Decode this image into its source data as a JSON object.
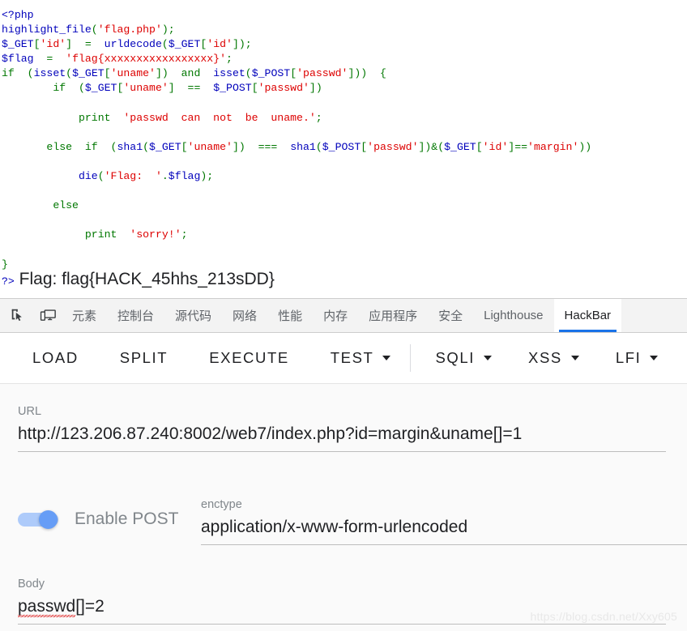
{
  "php_output": {
    "code_lines": [
      [
        {
          "t": "<?php",
          "c": "def"
        }
      ],
      [
        {
          "t": "highlight_file",
          "c": "def"
        },
        {
          "t": "(",
          "c": "kw"
        },
        {
          "t": "'flag.php'",
          "c": "str"
        },
        {
          "t": ")",
          "c": "kw"
        },
        {
          "t": ";",
          "c": "kw"
        }
      ],
      [
        {
          "t": "$_GET",
          "c": "var"
        },
        {
          "t": "[",
          "c": "kw"
        },
        {
          "t": "'id'",
          "c": "str"
        },
        {
          "t": "]",
          "c": "kw"
        },
        {
          "t": "  =  ",
          "c": "kw"
        },
        {
          "t": "urldecode",
          "c": "def"
        },
        {
          "t": "(",
          "c": "kw"
        },
        {
          "t": "$_GET",
          "c": "var"
        },
        {
          "t": "[",
          "c": "kw"
        },
        {
          "t": "'id'",
          "c": "str"
        },
        {
          "t": "]",
          "c": "kw"
        },
        {
          "t": ");",
          "c": "kw"
        }
      ],
      [
        {
          "t": "$flag",
          "c": "var"
        },
        {
          "t": "  =  ",
          "c": "kw"
        },
        {
          "t": "'flag{xxxxxxxxxxxxxxxxx}'",
          "c": "str"
        },
        {
          "t": ";",
          "c": "kw"
        }
      ],
      [
        {
          "t": "if",
          "c": "kw"
        },
        {
          "t": "  (",
          "c": "kw"
        },
        {
          "t": "isset",
          "c": "def"
        },
        {
          "t": "(",
          "c": "kw"
        },
        {
          "t": "$_GET",
          "c": "var"
        },
        {
          "t": "[",
          "c": "kw"
        },
        {
          "t": "'uname'",
          "c": "str"
        },
        {
          "t": "])",
          "c": "kw"
        },
        {
          "t": "  and  ",
          "c": "kw"
        },
        {
          "t": "isset",
          "c": "def"
        },
        {
          "t": "(",
          "c": "kw"
        },
        {
          "t": "$_POST",
          "c": "var"
        },
        {
          "t": "[",
          "c": "kw"
        },
        {
          "t": "'passwd'",
          "c": "str"
        },
        {
          "t": "]))",
          "c": "kw"
        },
        {
          "t": "  {",
          "c": "kw"
        }
      ],
      [
        {
          "t": "        ",
          "c": "kw"
        },
        {
          "t": "if",
          "c": "kw"
        },
        {
          "t": "  (",
          "c": "kw"
        },
        {
          "t": "$_GET",
          "c": "var"
        },
        {
          "t": "[",
          "c": "kw"
        },
        {
          "t": "'uname'",
          "c": "str"
        },
        {
          "t": "]",
          "c": "kw"
        },
        {
          "t": "  ==  ",
          "c": "kw"
        },
        {
          "t": "$_POST",
          "c": "var"
        },
        {
          "t": "[",
          "c": "kw"
        },
        {
          "t": "'passwd'",
          "c": "str"
        },
        {
          "t": "])",
          "c": "kw"
        }
      ],
      [
        {
          "t": "",
          "c": "kw"
        }
      ],
      [
        {
          "t": "            ",
          "c": "kw"
        },
        {
          "t": "print",
          "c": "kw"
        },
        {
          "t": "  ",
          "c": "kw"
        },
        {
          "t": "'passwd  can  not  be  uname.'",
          "c": "str"
        },
        {
          "t": ";",
          "c": "kw"
        }
      ],
      [
        {
          "t": "",
          "c": "kw"
        }
      ],
      [
        {
          "t": "       ",
          "c": "kw"
        },
        {
          "t": "else",
          "c": "kw"
        },
        {
          "t": "  ",
          "c": "kw"
        },
        {
          "t": "if",
          "c": "kw"
        },
        {
          "t": "  (",
          "c": "kw"
        },
        {
          "t": "sha1",
          "c": "def"
        },
        {
          "t": "(",
          "c": "kw"
        },
        {
          "t": "$_GET",
          "c": "var"
        },
        {
          "t": "[",
          "c": "kw"
        },
        {
          "t": "'uname'",
          "c": "str"
        },
        {
          "t": "])",
          "c": "kw"
        },
        {
          "t": "  ===  ",
          "c": "kw"
        },
        {
          "t": "sha1",
          "c": "def"
        },
        {
          "t": "(",
          "c": "kw"
        },
        {
          "t": "$_POST",
          "c": "var"
        },
        {
          "t": "[",
          "c": "kw"
        },
        {
          "t": "'passwd'",
          "c": "str"
        },
        {
          "t": "])&(",
          "c": "kw"
        },
        {
          "t": "$_GET",
          "c": "var"
        },
        {
          "t": "[",
          "c": "kw"
        },
        {
          "t": "'id'",
          "c": "str"
        },
        {
          "t": "]==",
          "c": "kw"
        },
        {
          "t": "'margin'",
          "c": "str"
        },
        {
          "t": "))",
          "c": "kw"
        }
      ],
      [
        {
          "t": "",
          "c": "kw"
        }
      ],
      [
        {
          "t": "            ",
          "c": "kw"
        },
        {
          "t": "die",
          "c": "def"
        },
        {
          "t": "(",
          "c": "kw"
        },
        {
          "t": "'Flag:  '",
          "c": "str"
        },
        {
          "t": ".",
          "c": "kw"
        },
        {
          "t": "$flag",
          "c": "var"
        },
        {
          "t": ");",
          "c": "kw"
        }
      ],
      [
        {
          "t": "",
          "c": "kw"
        }
      ],
      [
        {
          "t": "        ",
          "c": "kw"
        },
        {
          "t": "else",
          "c": "kw"
        }
      ],
      [
        {
          "t": "",
          "c": "kw"
        }
      ],
      [
        {
          "t": "             ",
          "c": "kw"
        },
        {
          "t": "print",
          "c": "kw"
        },
        {
          "t": "  ",
          "c": "kw"
        },
        {
          "t": "'sorry!'",
          "c": "str"
        },
        {
          "t": ";",
          "c": "kw"
        }
      ],
      [
        {
          "t": "",
          "c": "kw"
        }
      ],
      [
        {
          "t": "}",
          "c": "kw"
        }
      ]
    ],
    "closing_tag": "?>",
    "flag_text": " Flag: flag{HACK_45hhs_213sDD}"
  },
  "devtools": {
    "inspect_icon_name": "inspect-element-icon",
    "device_icon_name": "device-toolbar-icon",
    "tabs": [
      {
        "label": "元素",
        "active": false
      },
      {
        "label": "控制台",
        "active": false
      },
      {
        "label": "源代码",
        "active": false
      },
      {
        "label": "网络",
        "active": false
      },
      {
        "label": "性能",
        "active": false
      },
      {
        "label": "内存",
        "active": false
      },
      {
        "label": "应用程序",
        "active": false
      },
      {
        "label": "安全",
        "active": false
      },
      {
        "label": "Lighthouse",
        "active": false
      },
      {
        "label": "HackBar",
        "active": true
      }
    ],
    "active_tab_accent": "#1a73e8"
  },
  "hackbar": {
    "toolbar": {
      "load": "LOAD",
      "split": "SPLIT",
      "execute": "EXECUTE",
      "test": "TEST",
      "sqli": "SQLI",
      "xss": "XSS",
      "lfi": "LFI"
    },
    "url_field": {
      "label": "URL",
      "value": "http://123.206.87.240:8002/web7/index.php?id=margin&uname[]=1"
    },
    "post_toggle": {
      "label": "Enable POST",
      "enabled": true,
      "on_color": "#669df6",
      "track_color": "#aecbfa"
    },
    "enctype_field": {
      "label": "enctype",
      "value": "application/x-www-form-urlencoded"
    },
    "body_field": {
      "label": "Body",
      "value_misspelled": "passwd",
      "value_rest": "[]=2"
    }
  },
  "watermark": "https://blog.csdn.net/Xxy605"
}
